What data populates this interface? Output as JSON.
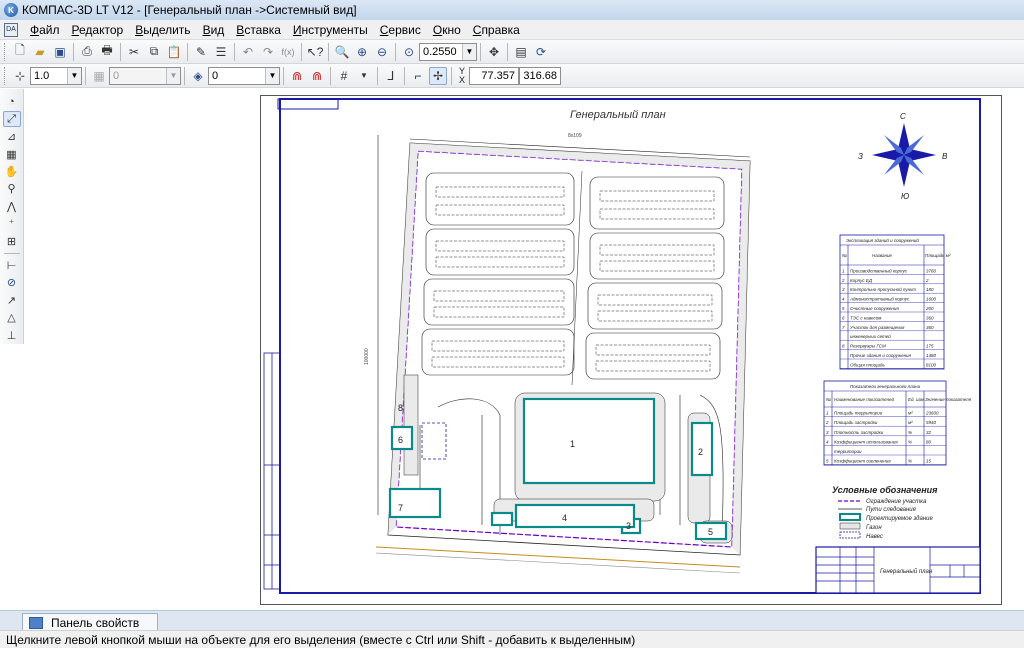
{
  "window": {
    "title": "КОМПАС-3D LT V12 - [Генеральный план ->Системный вид]"
  },
  "menu": [
    "Файл",
    "Редактор",
    "Выделить",
    "Вид",
    "Вставка",
    "Инструменты",
    "Сервис",
    "Окно",
    "Справка"
  ],
  "toolbar": {
    "zoom_value": "0.2550"
  },
  "props": {
    "step": "1.0",
    "layer_number": "0",
    "layer": "0",
    "x": "77.357",
    "y": "316.68"
  },
  "drawing": {
    "title": "Генеральный план",
    "top_dim": "8x109",
    "side_dim": "100000",
    "buildings": [
      "1",
      "2",
      "3",
      "4",
      "5",
      "6",
      "7",
      "8"
    ],
    "compass": {
      "n": "С",
      "s": "Ю",
      "w": "З",
      "e": "В"
    },
    "explication": {
      "title": "Экспликация зданий и сооружений",
      "headers": [
        "№",
        "Название",
        "Площадь м²"
      ],
      "rows": [
        [
          "1",
          "Производственный корпус",
          "3780"
        ],
        [
          "2",
          "Корпус ЕД",
          "2"
        ],
        [
          "3",
          "Контрольно-пропускной пункт",
          "180"
        ],
        [
          "4",
          "Административный корпус",
          "1600"
        ],
        [
          "5",
          "Очистные сооружения",
          "200"
        ],
        [
          "6",
          "ТЭС с навесом",
          "360"
        ],
        [
          "7",
          "Участок для размещения",
          "360"
        ],
        [
          "",
          "инженерных сетей",
          ""
        ],
        [
          "8",
          "Резервуары ГСМ",
          "175"
        ],
        [
          "",
          "Прочие здания и сооружения",
          "1480"
        ],
        [
          "",
          "Общая площадь",
          "8100"
        ]
      ]
    },
    "indicators": {
      "title": "Показатели генерального плана",
      "headers": [
        "№",
        "Наименование показателей",
        "Ед. изм.",
        "Значение показателя"
      ],
      "rows": [
        [
          "1",
          "Площадь территории",
          "м²",
          "23600"
        ],
        [
          "2",
          "Площадь застройки",
          "м²",
          "5940"
        ],
        [
          "3",
          "Плотность застройки",
          "%",
          "32"
        ],
        [
          "4",
          "Коэффициент использования",
          "%",
          "80"
        ],
        [
          "",
          "территории",
          "",
          ""
        ],
        [
          "5",
          "Коэффициент озеленения",
          "%",
          "15"
        ]
      ]
    },
    "legend": {
      "title": "Условные обозначения",
      "items": [
        "Ограждение участка",
        "Пути следования",
        "Проектируемое здание",
        "Газон",
        "Навес"
      ]
    },
    "stamp": {
      "title": "Генеральный план"
    }
  },
  "panel": {
    "tab_label": "Панель свойств"
  },
  "status": {
    "text": "Щелкните левой кнопкой мыши на объекте для его выделения (вместе с Ctrl или Shift - добавить к выделенным)"
  }
}
